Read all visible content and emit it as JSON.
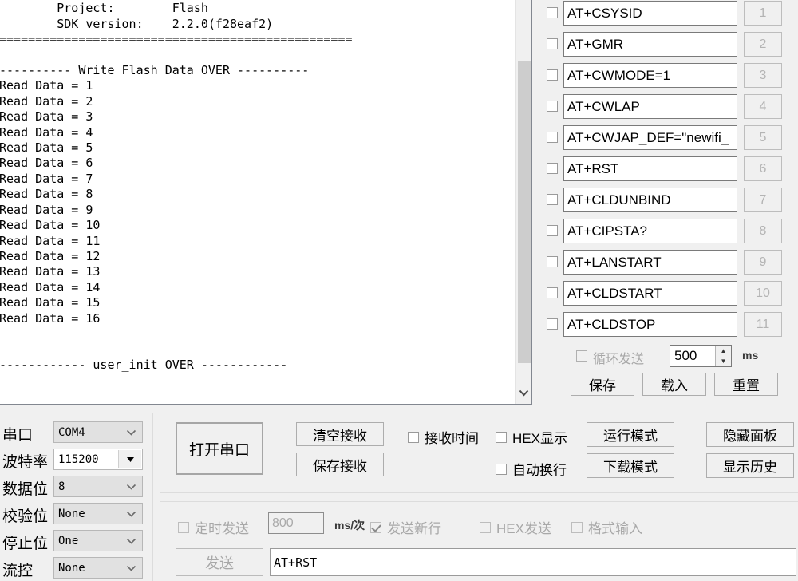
{
  "terminal": {
    "lines": [
      "                                                         ",
      "        Project:        Flash",
      "        SDK version:    2.2.0(f28eaf2)",
      "=================================================",
      "",
      "---------- Write Flash Data OVER ----------",
      "Read Data = 1",
      "Read Data = 2",
      "Read Data = 3",
      "Read Data = 4",
      "Read Data = 5",
      "Read Data = 6",
      "Read Data = 7",
      "Read Data = 8",
      "Read Data = 9",
      "Read Data = 10",
      "Read Data = 11",
      "Read Data = 12",
      "Read Data = 13",
      "Read Data = 14",
      "Read Data = 15",
      "Read Data = 16",
      "",
      "",
      "------------ user_init OVER ------------",
      ""
    ]
  },
  "at_panel": {
    "commands": [
      {
        "text": "AT+CSYSID",
        "num": "1",
        "checked": false
      },
      {
        "text": "AT+GMR",
        "num": "2",
        "checked": false
      },
      {
        "text": "AT+CWMODE=1",
        "num": "3",
        "checked": false
      },
      {
        "text": "AT+CWLAP",
        "num": "4",
        "checked": false
      },
      {
        "text": "AT+CWJAP_DEF=\"newifi_",
        "num": "5",
        "checked": false
      },
      {
        "text": "AT+RST",
        "num": "6",
        "checked": false
      },
      {
        "text": "AT+CLDUNBIND",
        "num": "7",
        "checked": false
      },
      {
        "text": "AT+CIPSTA?",
        "num": "8",
        "checked": false
      },
      {
        "text": "AT+LANSTART",
        "num": "9",
        "checked": false
      },
      {
        "text": "AT+CLDSTART",
        "num": "10",
        "checked": false
      },
      {
        "text": "AT+CLDSTOP",
        "num": "11",
        "checked": false
      }
    ],
    "loop_send_label": "循环发送",
    "loop_send_value": "500",
    "loop_send_unit": "ms",
    "save_label": "保存",
    "load_label": "载入",
    "reset_label": "重置"
  },
  "serial_config": {
    "rows": [
      {
        "label": "串口",
        "value": "COM4",
        "style": "combo"
      },
      {
        "label": "波特率",
        "value": "115200",
        "style": "editable"
      },
      {
        "label": "数据位",
        "value": "8",
        "style": "combo"
      },
      {
        "label": "校验位",
        "value": "None",
        "style": "combo"
      },
      {
        "label": "停止位",
        "value": "One",
        "style": "combo"
      },
      {
        "label": "流控",
        "value": "None",
        "style": "combo"
      }
    ]
  },
  "control_panel": {
    "open_port": "打开串口",
    "clear_receive": "清空接收",
    "save_receive": "保存接收",
    "show_time": {
      "label": "接收时间",
      "checked": false
    },
    "hex_display": {
      "label": "HEX显示",
      "checked": false
    },
    "auto_wrap": {
      "label": "自动换行",
      "checked": false
    },
    "run_mode": "运行模式",
    "download_mode": "下载模式",
    "hide_panel": "隐藏面板",
    "show_history": "显示历史"
  },
  "send_panel": {
    "timed_send": {
      "label": "定时发送",
      "checked": false
    },
    "interval_value": "800",
    "interval_unit": "ms/次",
    "send_newline": {
      "label": "发送新行",
      "checked": true
    },
    "hex_send": {
      "label": "HEX发送",
      "checked": false
    },
    "format_input": {
      "label": "格式输入",
      "checked": false
    },
    "send_button": "发送",
    "send_input_value": "AT+RST"
  },
  "colors": {
    "window_bg": "#f0f0f0",
    "terminal_bg": "#ffffff",
    "text": "#000000",
    "disabled_text": "#a8a8a8",
    "scrollbar_thumb": "#cdcdcd"
  }
}
